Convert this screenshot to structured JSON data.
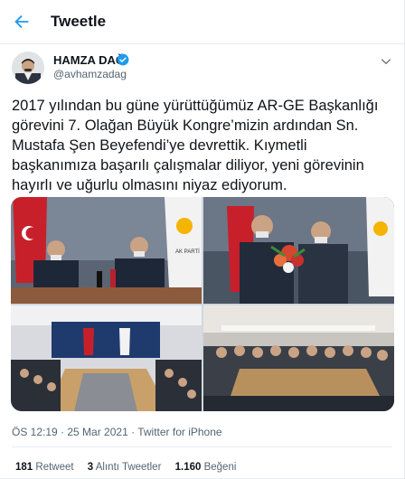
{
  "header": {
    "title": "Tweetle"
  },
  "author": {
    "name": "HAMZA DAĞ",
    "handle": "@avhamzadag"
  },
  "tweet": {
    "text": "2017 yılından bu güne yürüttüğümüz AR-GE Başkanlığı\ngörevini 7. Olağan Büyük Kongre’mizin ardından Sn.\nMustafa Şen Beyefendi’ye devrettik. Kıymetli\nbaşkanımıza başarılı çalışmalar diliyor, yeni görevinin\nhayırlı ve uğurlu olmasını niyaz ediyorum.",
    "meta": "ÖS 12:19 · 25 Mar 2021 · Twitter for iPhone"
  },
  "stats": {
    "retweets_count": "181",
    "retweets_label": "Retweet",
    "quotes_count": "3",
    "quotes_label": "Alıntı Tweetler",
    "likes_count": "1.160",
    "likes_label": "Beğeni"
  },
  "photos": {
    "flag_caption": "AK PARTİ"
  },
  "colors": {
    "accent": "#1d9bf0",
    "muted": "#536471",
    "border": "#e6ecf0"
  },
  "icons": {
    "back": "arrow-left-icon",
    "verified": "verified-badge-icon",
    "more": "chevron-down-icon"
  }
}
